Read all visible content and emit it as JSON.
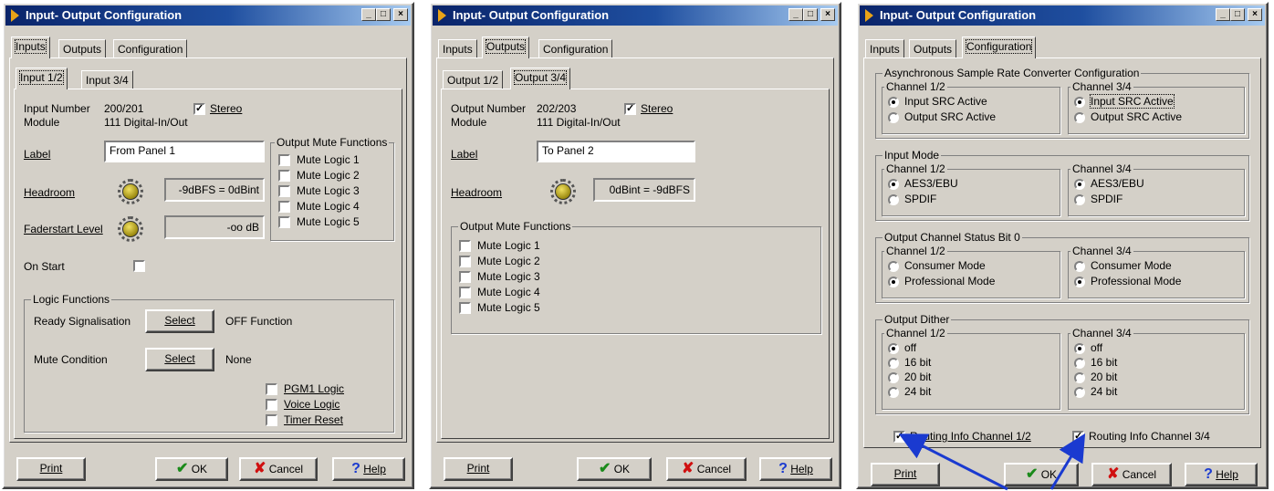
{
  "colors": {
    "accent_arrow": "#1a3ad0",
    "title_bar": "#0a246a"
  },
  "window_title": "Input- Output Configuration",
  "title_buttons": {
    "min": "_",
    "max": "□",
    "close": "×"
  },
  "tabs": {
    "inputs": "Inputs",
    "outputs": "Outputs",
    "configuration": "Configuration"
  },
  "footer": {
    "print": "Print",
    "ok": "OK",
    "cancel": "Cancel",
    "help": "Help"
  },
  "icons": {
    "check": "✔",
    "cross": "✘",
    "question": "?"
  },
  "w1": {
    "subtabs": [
      "Input 1/2",
      "Input 3/4"
    ],
    "input_number_label": "Input Number",
    "input_number": "200/201",
    "stereo": "Stereo",
    "module_label": "Module",
    "module": "111 Digital-In/Out",
    "label_label": "Label",
    "label_value": "From Panel 1",
    "headroom_label": "Headroom",
    "headroom_value": "-9dBFS = 0dBint",
    "faderstart_label": "Faderstart Level",
    "faderstart_value": "-oo dB",
    "onstart_label": "On Start",
    "mute_group": "Output Mute Functions",
    "mute": [
      "Mute Logic 1",
      "Mute Logic 2",
      "Mute Logic 3",
      "Mute Logic 4",
      "Mute Logic 5"
    ],
    "logic_group": "Logic Functions",
    "ready_label": "Ready Signalisation",
    "select": "Select",
    "ready_value": "OFF Function",
    "mutecond_label": "Mute Condition",
    "mutecond_value": "None",
    "pgm1": "PGM1 Logic",
    "voice": "Voice Logic",
    "timer": "Timer Reset"
  },
  "w2": {
    "subtabs": [
      "Output 1/2",
      "Output 3/4"
    ],
    "output_number_label": "Output Number",
    "output_number": "202/203",
    "stereo": "Stereo",
    "module_label": "Module",
    "module": "111 Digital-In/Out",
    "label_label": "Label",
    "label_value": "To Panel 2",
    "headroom_label": "Headroom",
    "headroom_value": "0dBint = -9dBFS",
    "mute_group": "Output Mute Functions",
    "mute": [
      "Mute Logic 1",
      "Mute Logic 2",
      "Mute Logic 3",
      "Mute Logic 4",
      "Mute Logic 5"
    ]
  },
  "w3": {
    "src_group": "Asynchronous Sample Rate Converter Configuration",
    "ch12": "Channel 1/2",
    "ch34": "Channel 3/4",
    "src_opts": [
      "Input SRC Active",
      "Output SRC Active"
    ],
    "inmode_group": "Input Mode",
    "inmode_opts": [
      "AES3/EBU",
      "SPDIF"
    ],
    "status_group": "Output Channel Status Bit 0",
    "status_opts": [
      "Consumer Mode",
      "Professional Mode"
    ],
    "dither_group": "Output Dither",
    "dither_opts": [
      "off",
      "16 bit",
      "20 bit",
      "24 bit"
    ],
    "routing12": "Routing Info Channel 1/2",
    "routing34": "Routing Info Channel 3/4"
  }
}
